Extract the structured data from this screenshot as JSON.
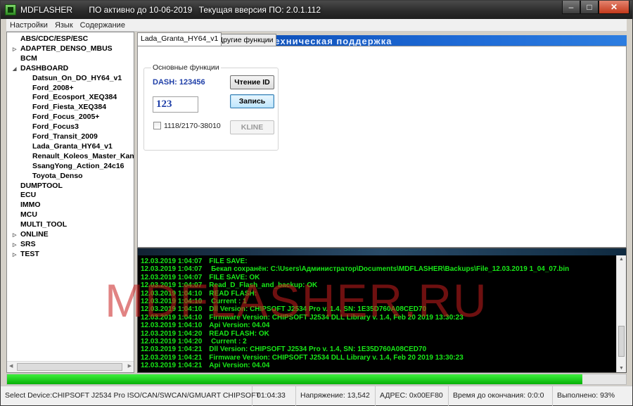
{
  "window": {
    "app_name": "MDFLASHER",
    "license": "ПО активно до 10-06-2019",
    "version": "Текущая вверсия ПО: 2.0.1.112",
    "minimize": "–",
    "maximize": "□",
    "close": "✕"
  },
  "menu": [
    "Настройки",
    "Язык",
    "Содержание"
  ],
  "tree": [
    {
      "label": "ABS/CDC/ESP/ESC",
      "arrow": ""
    },
    {
      "label": "ADAPTER_DENSO_MBUS",
      "arrow": "▷"
    },
    {
      "label": "BCM",
      "arrow": ""
    },
    {
      "label": "DASHBOARD",
      "arrow": "◢"
    },
    {
      "label": "Datsun_On_DO_HY64_v1",
      "arrow": ""
    },
    {
      "label": "Ford_2008+",
      "arrow": ""
    },
    {
      "label": "Ford_Ecosport_XEQ384",
      "arrow": ""
    },
    {
      "label": "Ford_Fiesta_XEQ384",
      "arrow": ""
    },
    {
      "label": "Ford_Focus_2005+",
      "arrow": ""
    },
    {
      "label": "Ford_Focus3",
      "arrow": ""
    },
    {
      "label": "Ford_Transit_2009",
      "arrow": ""
    },
    {
      "label": "Lada_Granta_HY64_v1",
      "arrow": ""
    },
    {
      "label": "Renault_Koleos_Master_Kan",
      "arrow": ""
    },
    {
      "label": "SsangYong_Action_24c16",
      "arrow": ""
    },
    {
      "label": "Toyota_Denso",
      "arrow": ""
    },
    {
      "label": "DUMPTOOL",
      "arrow": ""
    },
    {
      "label": "ECU",
      "arrow": ""
    },
    {
      "label": "IMMO",
      "arrow": ""
    },
    {
      "label": "MCU",
      "arrow": ""
    },
    {
      "label": "MULTI_TOOL",
      "arrow": ""
    },
    {
      "label": "ONLINE",
      "arrow": "▷"
    },
    {
      "label": "SRS",
      "arrow": "▷"
    },
    {
      "label": "TEST",
      "arrow": "▷"
    }
  ],
  "tabs": {
    "active": "Lada_Granta_HY64_v1",
    "other": "Другие функции",
    "banner": "SHER.RU  техническая поддержка"
  },
  "functions": {
    "group_title": "Основные функции",
    "dash_label": "DASH: 123456",
    "read_id": "Чтение ID",
    "write": "Запись",
    "value": "123",
    "checkbox_label": "1118/2170-38010",
    "kline": "KLINE"
  },
  "log": [
    {
      "ts": "12.03.2019 1:04:07",
      "msg": "FILE SAVE:"
    },
    {
      "ts": "12.03.2019 1:04:07",
      "msg": " Бекап сохранён:   C:\\Users\\Администратор\\Documents\\MDFLASHER\\Backups\\File_12.03.2019 1_04_07.bin"
    },
    {
      "ts": "12.03.2019 1:04:07",
      "msg": "FILE SAVE:   OK"
    },
    {
      "ts": "12.03.2019 1:04:07",
      "msg": "Read_D_Flash_and_backup:  OK"
    },
    {
      "ts": "12.03.2019 1:04:10",
      "msg": "READ FLASH:"
    },
    {
      "ts": "12.03.2019 1:04:10",
      "msg": " Current :  1"
    },
    {
      "ts": "12.03.2019 1:04:10",
      "msg": "Dll Version:  CHIPSOFT J2534 Pro v. 1.4, SN: 1E35D760A08CED70"
    },
    {
      "ts": "12.03.2019 1:04:10",
      "msg": "Firmware Version:  CHIPSOFT J2534 DLL Library v. 1.4, Feb 20 2019 13:30:23"
    },
    {
      "ts": "12.03.2019 1:04:10",
      "msg": "Api Version:  04.04"
    },
    {
      "ts": "12.03.2019 1:04:20",
      "msg": "READ FLASH:  OK"
    },
    {
      "ts": "12.03.2019 1:04:20",
      "msg": " Current :  2"
    },
    {
      "ts": "12.03.2019 1:04:21",
      "msg": "Dll Version:  CHIPSOFT J2534 Pro v. 1.4, SN: 1E35D760A08CED70"
    },
    {
      "ts": "12.03.2019 1:04:21",
      "msg": "Firmware Version:  CHIPSOFT J2534 DLL Library v. 1.4, Feb 20 2019 13:30:23"
    },
    {
      "ts": "12.03.2019 1:04:21",
      "msg": "Api Version:  04.04"
    }
  ],
  "watermark": "MDFLASHER.RU",
  "progress": {
    "fraction": 0.93,
    "color": "#06b006"
  },
  "status": {
    "device": "Select Device:CHIPSOFT J2534 Pro ISO/CAN/SWCAN/GMUART  CHIPSOFT",
    "time": "01:04:33",
    "voltage": "Напряжение:  13,542",
    "address": "АДРЕС: 0x00EF80",
    "remaining": "Время до окончания: 0:0:0",
    "done": "Выполнено: 93%"
  },
  "colors": {
    "log_text": "#18e818",
    "dash_label": "#1f3fa8",
    "watermark": "#c81e1e"
  }
}
